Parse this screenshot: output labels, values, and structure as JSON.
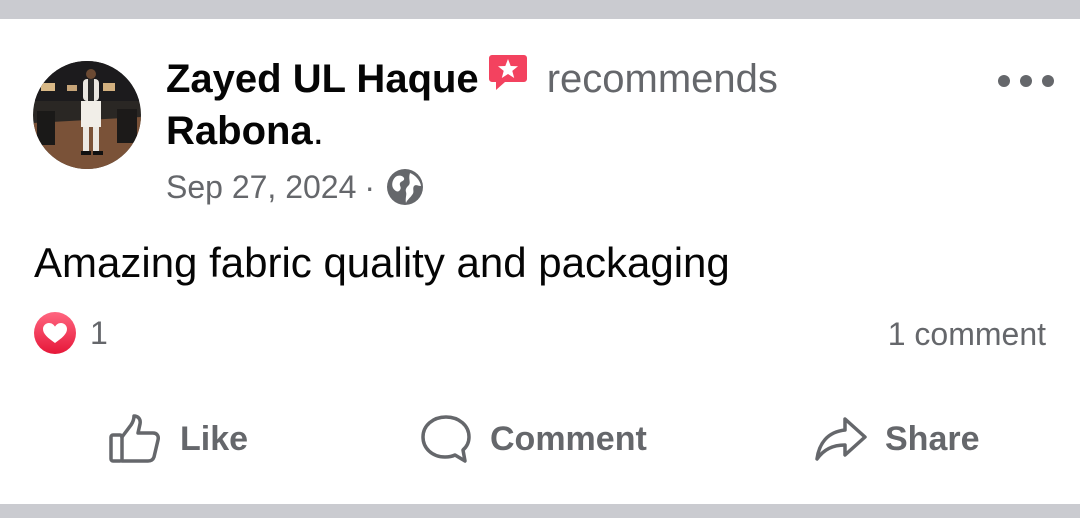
{
  "post": {
    "author": "Zayed UL Haque",
    "verb": "recommends",
    "page_name": "Rabona",
    "page_suffix": ".",
    "date": "Sep 27, 2024",
    "separator": "·",
    "privacy_icon": "globe-icon",
    "body": "Amazing fabric quality and packaging"
  },
  "reactions": {
    "icon": "love-reaction-icon",
    "count": "1",
    "comments": "1 comment"
  },
  "actions": {
    "like": "Like",
    "comment": "Comment",
    "share": "Share"
  },
  "colors": {
    "page_background": "#cacbd0",
    "card": "#ffffff",
    "primary_text": "#050505",
    "secondary_text": "#65676b",
    "recommend_badge": "#f3425f",
    "love_reaction": "#f33e58"
  }
}
